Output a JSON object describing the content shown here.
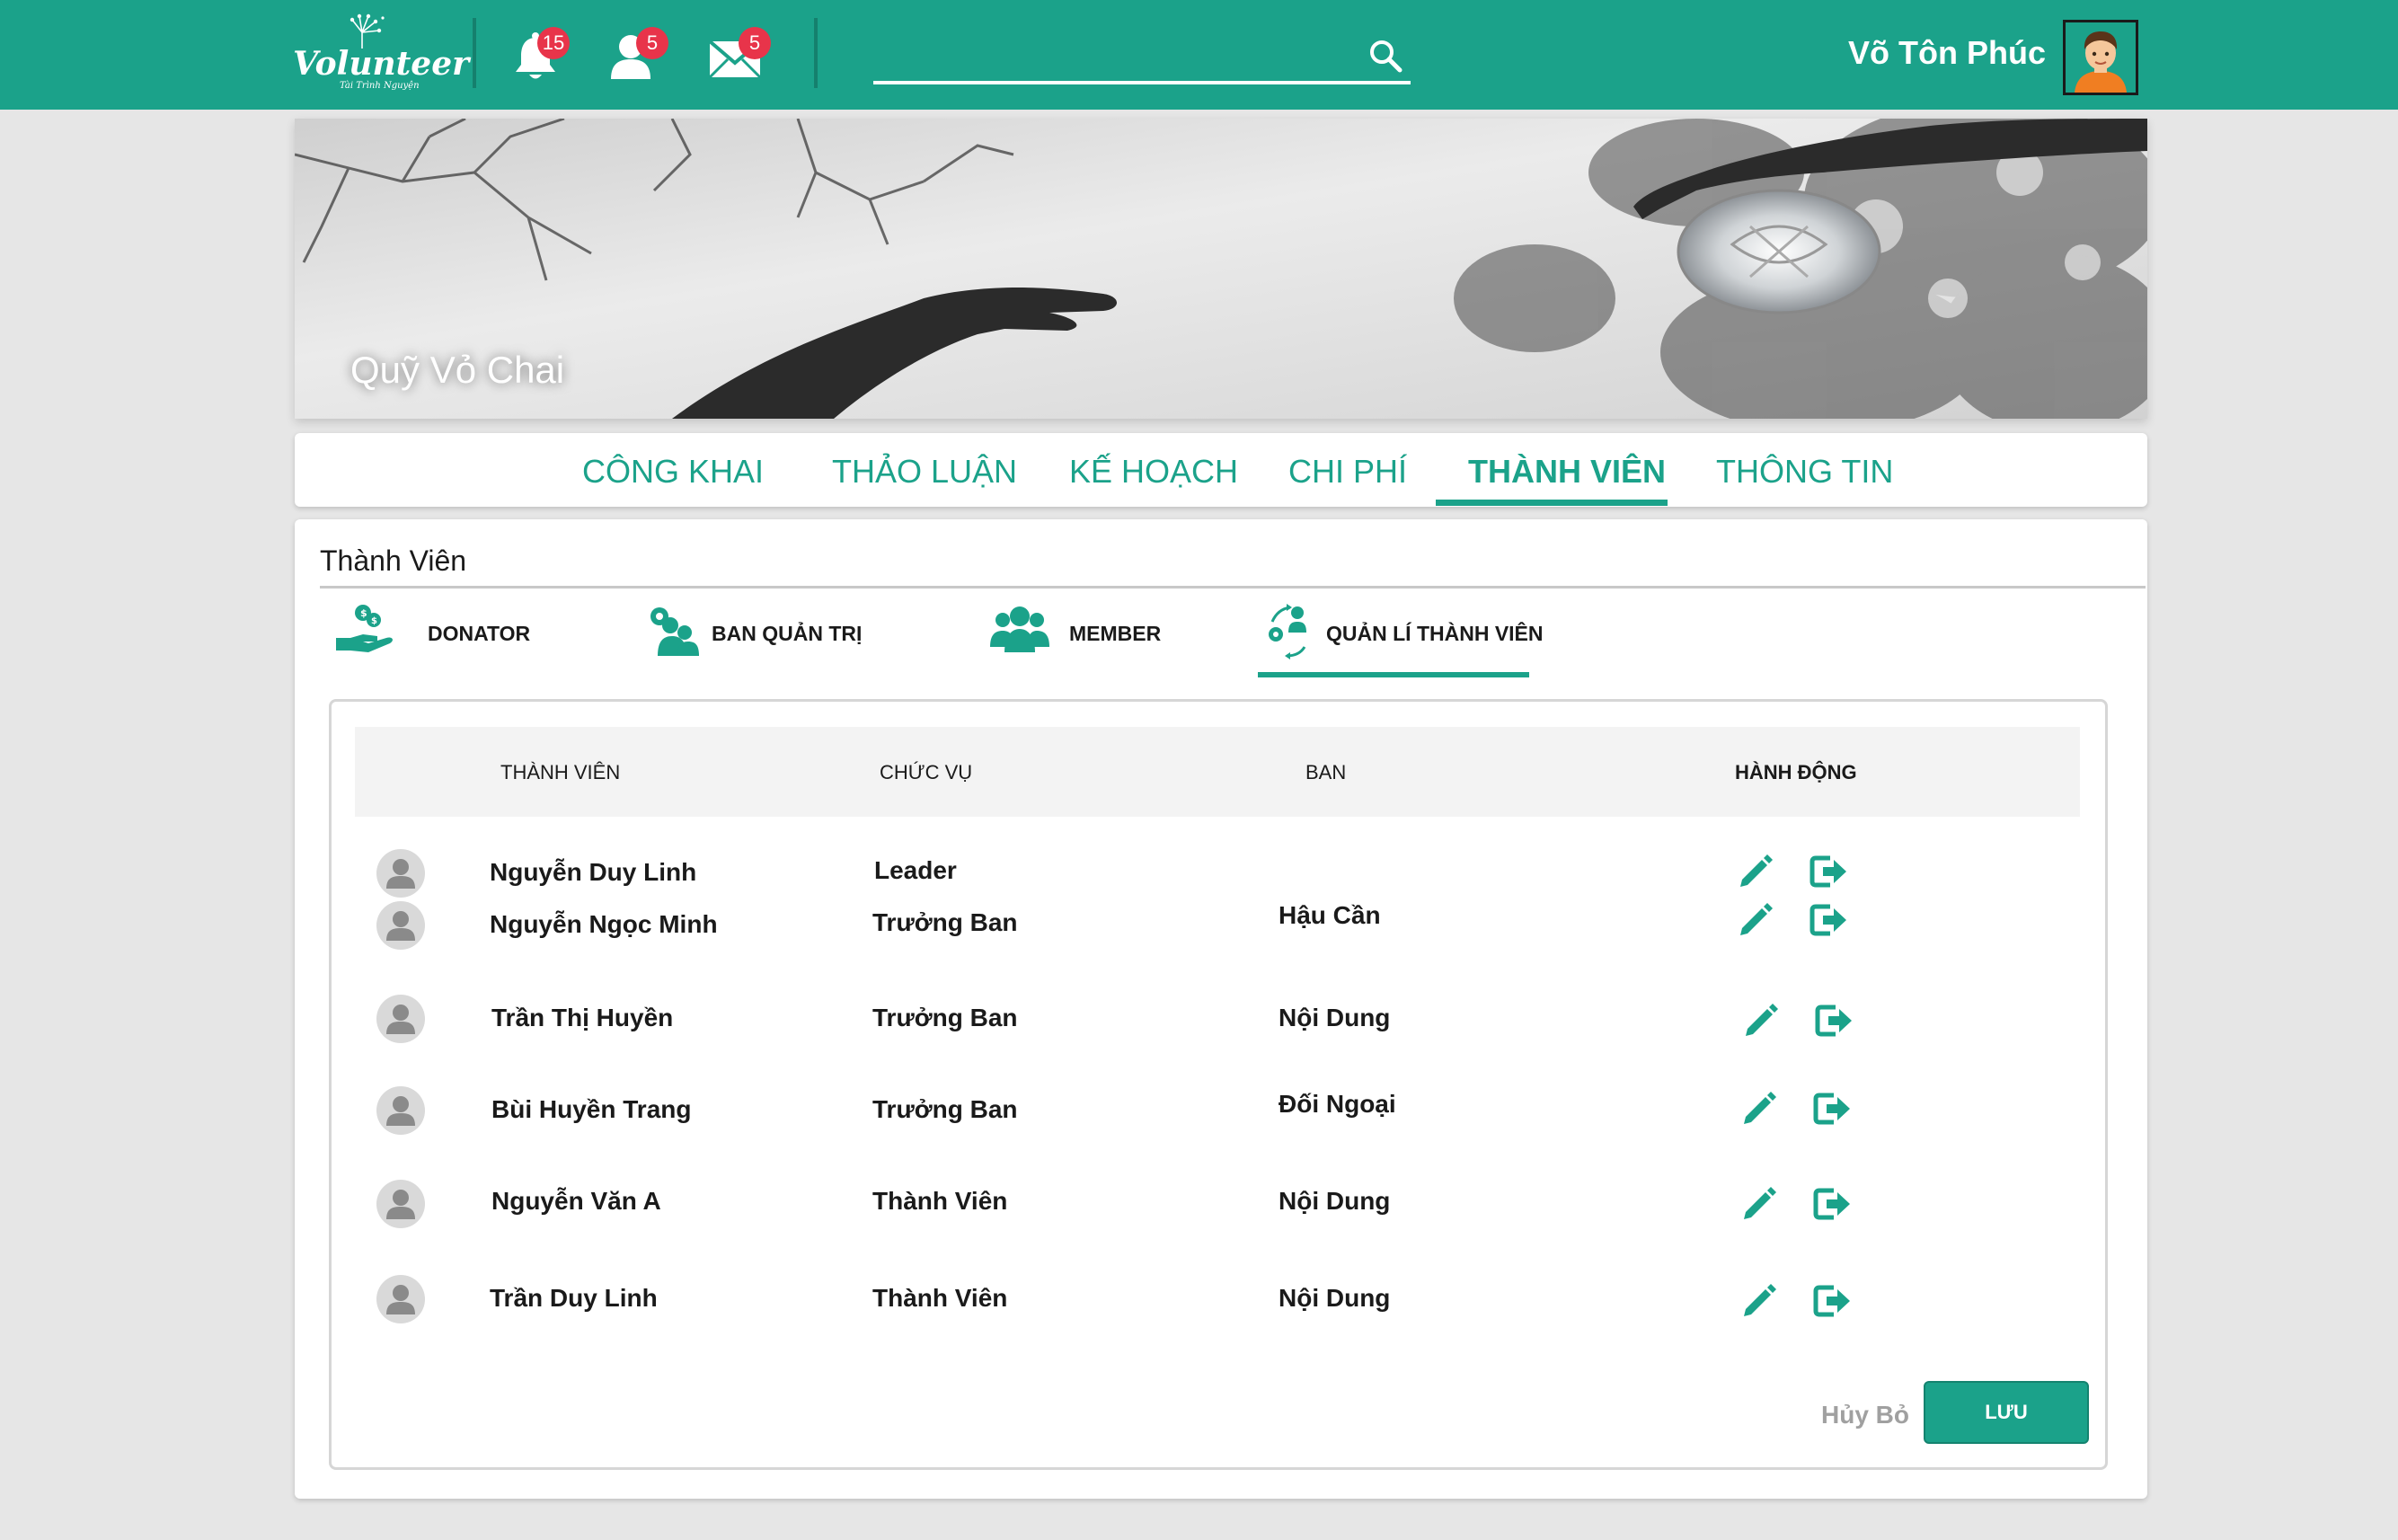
{
  "header": {
    "logo_text": "Volunteer",
    "logo_subtext": "Tài Trình Nguyện",
    "notifications_count": "15",
    "friend_requests_count": "5",
    "messages_count": "5",
    "search_placeholder": "",
    "user_name": "Võ Tôn Phúc"
  },
  "banner": {
    "title": "Quỹ Vỏ Chai"
  },
  "tabs": [
    {
      "label": "CÔNG KHAI"
    },
    {
      "label": "THẢO LUẬN"
    },
    {
      "label": "KẾ HOẠCH"
    },
    {
      "label": "CHI PHÍ"
    },
    {
      "label": "THÀNH VIÊN",
      "active": true
    },
    {
      "label": "THÔNG TIN"
    }
  ],
  "members": {
    "title": "Thành Viên",
    "subtabs": [
      {
        "label": "DONATOR",
        "icon": "donate-hand-icon"
      },
      {
        "label": "BAN QUẢN TRỊ",
        "icon": "admin-group-icon"
      },
      {
        "label": "MEMBER",
        "icon": "people-group-icon"
      },
      {
        "label": "QUẢN LÍ THÀNH VIÊN",
        "icon": "manage-members-icon",
        "active": true
      }
    ],
    "columns": {
      "member": "THÀNH VIÊN",
      "role": "CHỨC VỤ",
      "team": "BAN",
      "actions": "HÀNH ĐỘNG"
    },
    "rows": [
      {
        "name": "Nguyễn Duy Linh",
        "role": "Leader",
        "team": ""
      },
      {
        "name": "Nguyễn Ngọc Minh",
        "role": "Trưởng Ban",
        "team": "Hậu Cần"
      },
      {
        "name": "Trần Thị Huyền",
        "role": "Trưởng Ban",
        "team": "Nội Dung"
      },
      {
        "name": "Bùi Huyền Trang",
        "role": "Trưởng Ban",
        "team": "Đối Ngoại"
      },
      {
        "name": "Nguyễn Văn A",
        "role": "Thành Viên",
        "team": "Nội Dung"
      },
      {
        "name": "Trần Duy Linh",
        "role": "Thành Viên",
        "team": "Nội Dung"
      }
    ],
    "cancel_label": "Hủy Bỏ",
    "save_label": "LƯU"
  },
  "colors": {
    "brand": "#1ba28a",
    "badge": "#e8344a",
    "background": "#e6e6e6"
  }
}
